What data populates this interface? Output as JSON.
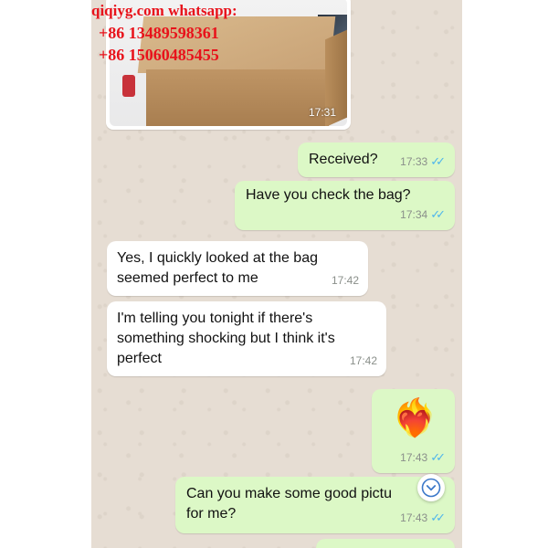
{
  "watermark": {
    "site": "qiqiyg.com",
    "whatsapp_label": "whatsapp:",
    "phone1": "+86 13489598361",
    "phone2": "+86 15060485455"
  },
  "photo_message": {
    "time": "17:31"
  },
  "messages": [
    {
      "direction": "out",
      "text": "Received?",
      "time": "17:33",
      "read": true
    },
    {
      "direction": "out",
      "text": "Have you check the bag?",
      "time": "17:34",
      "read": true
    },
    {
      "direction": "in",
      "text": "Yes, I quickly looked at the bag\nseemed perfect to me",
      "time": "17:42"
    },
    {
      "direction": "in",
      "text": "I'm telling you tonight if there's\nsomething shocking but I think it's\nperfect",
      "time": "17:42"
    },
    {
      "direction": "out",
      "emoji": "❤️‍🔥",
      "time": "17:43",
      "read": true
    },
    {
      "direction": "out",
      "text": "Can you make some good pictu\nfor me?",
      "time": "17:43",
      "read": true
    }
  ],
  "icons": {
    "scroll_down": "chevron-down-icon",
    "read_receipt": "double-check-icon"
  },
  "colors": {
    "outgoing": "#dcf8c6",
    "incoming": "#ffffff",
    "ticks": "#4fb6ec",
    "watermark": "#e8121b",
    "wallpaper": "#e6ddd3"
  }
}
